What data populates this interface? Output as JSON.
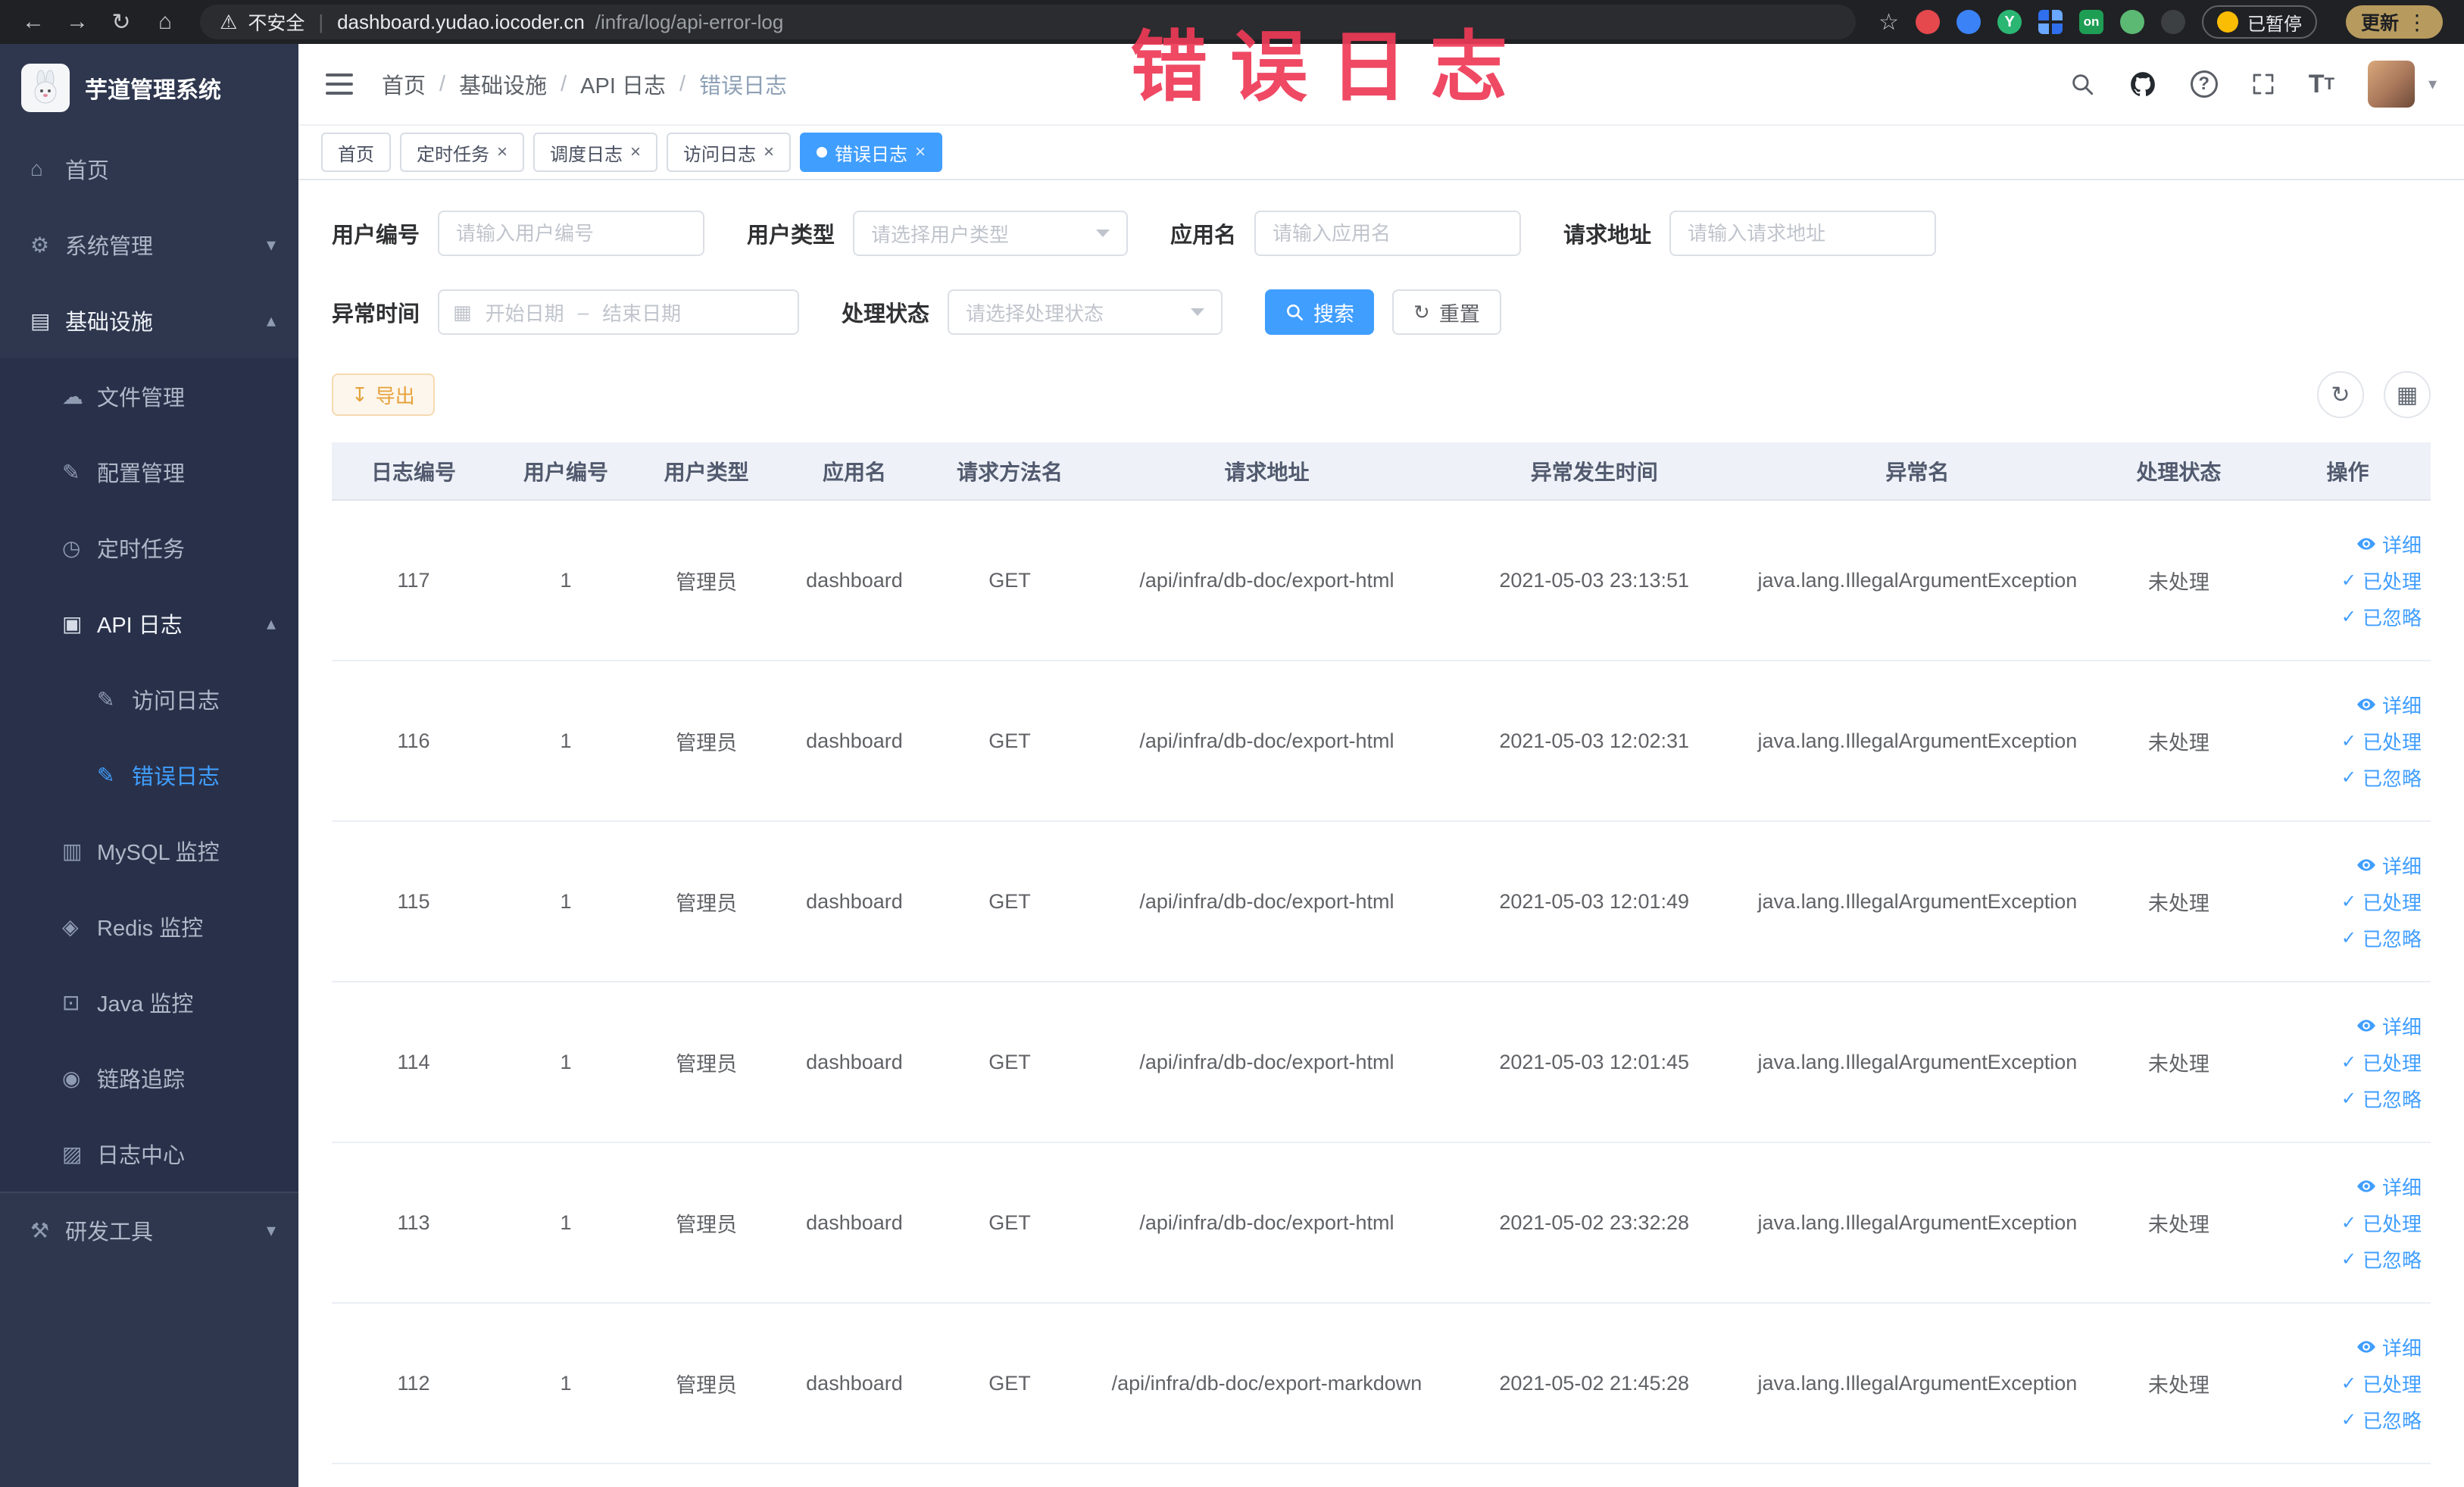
{
  "theme": {
    "accent": "#409eff",
    "watermark_color": "#ee3a57",
    "warning": "#e6a23c",
    "sidebar_bg": "#2e374e"
  },
  "watermark": {
    "text": "错误日志",
    "color": "#ee3a57"
  },
  "browser": {
    "security_label": "不安全",
    "url_host": "dashboard.yudao.iocoder.cn",
    "url_path": "/infra/log/api-error-log",
    "extension_badge_on": "on",
    "paused_label": "已暂停",
    "update_label": "更新"
  },
  "sidebar": {
    "title": "芋道管理系统",
    "items": [
      {
        "id": "home",
        "label": "首页",
        "glyph": "⌂",
        "level": 1
      },
      {
        "id": "system-management",
        "label": "系统管理",
        "glyph": "⚙",
        "level": 1,
        "arrow": "down"
      },
      {
        "id": "infrastructure",
        "label": "基础设施",
        "glyph": "▤",
        "level": 1,
        "arrow": "up",
        "trail": true
      },
      {
        "id": "file-management",
        "label": "文件管理",
        "glyph": "☁",
        "level": 2
      },
      {
        "id": "config-management",
        "label": "配置管理",
        "glyph": "✎",
        "level": 2
      },
      {
        "id": "scheduled-tasks",
        "label": "定时任务",
        "glyph": "◷",
        "level": 2
      },
      {
        "id": "api-logs",
        "label": "API 日志",
        "glyph": "▣",
        "level": 2,
        "arrow": "up",
        "trail": true
      },
      {
        "id": "access-log",
        "label": "访问日志",
        "glyph": "✎",
        "level": 3
      },
      {
        "id": "error-log",
        "label": "错误日志",
        "glyph": "✎",
        "level": 3,
        "active": true
      },
      {
        "id": "mysql-monitor",
        "label": "MySQL 监控",
        "glyph": "▥",
        "level": 2
      },
      {
        "id": "redis-monitor",
        "label": "Redis 监控",
        "glyph": "◈",
        "level": 2
      },
      {
        "id": "java-monitor",
        "label": "Java 监控",
        "glyph": "⊡",
        "level": 2
      },
      {
        "id": "link-trace",
        "label": "链路追踪",
        "glyph": "◉",
        "level": 2
      },
      {
        "id": "log-center",
        "label": "日志中心",
        "glyph": "▨",
        "level": 2
      },
      {
        "id": "dev-tools",
        "label": "研发工具",
        "glyph": "⚒",
        "level": 1,
        "arrow": "down",
        "divider": true
      }
    ]
  },
  "header": {
    "breadcrumb": [
      "首页",
      "基础设施",
      "API 日志",
      "错误日志"
    ],
    "breadcrumb_separator": "/"
  },
  "tabs": [
    {
      "label": "首页",
      "closable": false,
      "active": false
    },
    {
      "label": "定时任务",
      "closable": true,
      "active": false
    },
    {
      "label": "调度日志",
      "closable": true,
      "active": false
    },
    {
      "label": "访问日志",
      "closable": true,
      "active": false
    },
    {
      "label": "错误日志",
      "closable": true,
      "active": true
    }
  ],
  "filters": {
    "user_id_label": "用户编号",
    "user_id_placeholder": "请输入用户编号",
    "user_type_label": "用户类型",
    "user_type_placeholder": "请选择用户类型",
    "app_name_label": "应用名",
    "app_name_placeholder": "请输入应用名",
    "request_url_label": "请求地址",
    "request_url_placeholder": "请输入请求地址",
    "exception_time_label": "异常时间",
    "start_date_placeholder": "开始日期",
    "range_separator": "–",
    "end_date_placeholder": "结束日期",
    "process_status_label": "处理状态",
    "process_status_placeholder": "请选择处理状态",
    "search_label": "搜索",
    "reset_label": "重置"
  },
  "toolbar": {
    "export_label": "导出"
  },
  "table": {
    "columns": [
      "日志编号",
      "用户编号",
      "用户类型",
      "应用名",
      "请求方法名",
      "请求地址",
      "异常发生时间",
      "异常名",
      "处理状态",
      "操作"
    ],
    "col_widths": [
      7.8,
      6.7,
      6.7,
      7.4,
      7.4,
      17.1,
      14.1,
      16.7,
      8.2,
      7.9
    ],
    "actions": [
      "详细",
      "已处理",
      "已忽略"
    ],
    "rows": [
      {
        "id": "117",
        "user_id": "1",
        "user_type": "管理员",
        "app": "dashboard",
        "method": "GET",
        "url": "/api/infra/db-doc/export-html",
        "time": "2021-05-03 23:13:51",
        "exception": "java.lang.IllegalArgumentException",
        "status": "未处理"
      },
      {
        "id": "116",
        "user_id": "1",
        "user_type": "管理员",
        "app": "dashboard",
        "method": "GET",
        "url": "/api/infra/db-doc/export-html",
        "time": "2021-05-03 12:02:31",
        "exception": "java.lang.IllegalArgumentException",
        "status": "未处理"
      },
      {
        "id": "115",
        "user_id": "1",
        "user_type": "管理员",
        "app": "dashboard",
        "method": "GET",
        "url": "/api/infra/db-doc/export-html",
        "time": "2021-05-03 12:01:49",
        "exception": "java.lang.IllegalArgumentException",
        "status": "未处理"
      },
      {
        "id": "114",
        "user_id": "1",
        "user_type": "管理员",
        "app": "dashboard",
        "method": "GET",
        "url": "/api/infra/db-doc/export-html",
        "time": "2021-05-03 12:01:45",
        "exception": "java.lang.IllegalArgumentException",
        "status": "未处理"
      },
      {
        "id": "113",
        "user_id": "1",
        "user_type": "管理员",
        "app": "dashboard",
        "method": "GET",
        "url": "/api/infra/db-doc/export-html",
        "time": "2021-05-02 23:32:28",
        "exception": "java.lang.IllegalArgumentException",
        "status": "未处理"
      },
      {
        "id": "112",
        "user_id": "1",
        "user_type": "管理员",
        "app": "dashboard",
        "method": "GET",
        "url": "/api/infra/db-doc/export-markdown",
        "time": "2021-05-02 21:45:28",
        "exception": "java.lang.IllegalArgumentException",
        "status": "未处理"
      }
    ]
  }
}
